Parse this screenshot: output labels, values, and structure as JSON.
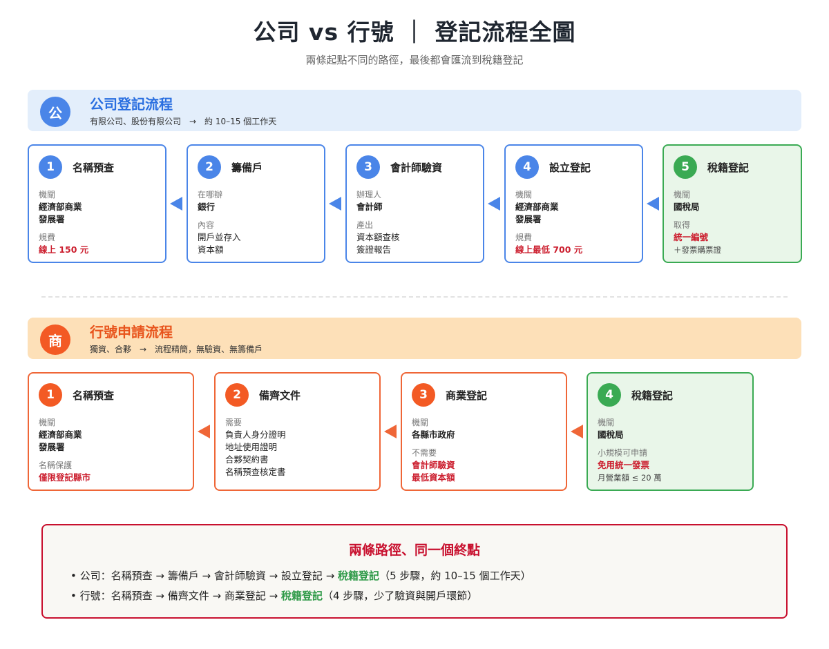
{
  "title": "公司 vs 行號 ｜ 登記流程全圖",
  "subtitle": "兩條起點不同的路徑，最後都會匯流到稅籍登記",
  "company": {
    "badge": "公",
    "title": "公司登記流程",
    "subtitle": "有限公司、股份有限公司　→　約 10–15 個工作天",
    "steps": [
      {
        "num": "1",
        "title": "名稱預查",
        "l1": "機關",
        "v1": "經濟部商業\n發展署",
        "l2": "規費",
        "v2": "線上 150 元"
      },
      {
        "num": "2",
        "title": "籌備戶",
        "l1": "在哪辦",
        "v1": "銀行",
        "l2": "內容",
        "v2": "開戶並存入\n資本額"
      },
      {
        "num": "3",
        "title": "會計師驗資",
        "l1": "辦理人",
        "v1": "會計師",
        "l2": "產出",
        "v2": "資本額查核\n簽證報告"
      },
      {
        "num": "4",
        "title": "設立登記",
        "l1": "機關",
        "v1": "經濟部商業\n發展署",
        "l2": "規費",
        "v2": "線上最低 700 元"
      },
      {
        "num": "5",
        "title": "稅籍登記",
        "l1": "機關",
        "v1": "國稅局",
        "l2": "取得",
        "v2": "統一編號",
        "v3": "＋發票購票證"
      }
    ]
  },
  "shop": {
    "badge": "商",
    "title": "行號申請流程",
    "subtitle": "獨資、合夥　→　流程精簡，無驗資、無籌備戶",
    "steps": [
      {
        "num": "1",
        "title": "名稱預查",
        "l1": "機關",
        "v1": "經濟部商業\n發展署",
        "l2": "名稱保護",
        "v2": "僅限登記縣市"
      },
      {
        "num": "2",
        "title": "備齊文件",
        "l1": "需要",
        "v1": "負責人身分證明\n地址使用證明\n合夥契約書\n名稱預查核定書"
      },
      {
        "num": "3",
        "title": "商業登記",
        "l1": "機關",
        "v1": "各縣市政府",
        "l2": "不需要",
        "v2": "會計師驗資\n最低資本額"
      },
      {
        "num": "4",
        "title": "稅籍登記",
        "l1": "機關",
        "v1": "國稅局",
        "l2": "小規模可申請",
        "v2": "免用統一發票",
        "v3": "月營業額 ≤ 20 萬"
      }
    ]
  },
  "summary": {
    "title": "兩條路徑、同一個終點",
    "line1": {
      "prefix": "• 公司：名稱預查 → 籌備戶 → 會計師驗資 → 設立登記 → ",
      "highlight": "稅籍登記",
      "suffix": "（5 步驟，約 10–15 個工作天）"
    },
    "line2": {
      "prefix": "• 行號：名稱預查 → 備齊文件 → 商業登記 → ",
      "highlight": "稅籍登記",
      "suffix": "（4 步驟，少了驗資與開戶環節）"
    }
  },
  "colors": {
    "blue": "#4a85e8",
    "orange": "#f35a24",
    "green": "#3aaa53",
    "red": "#c8102e"
  }
}
